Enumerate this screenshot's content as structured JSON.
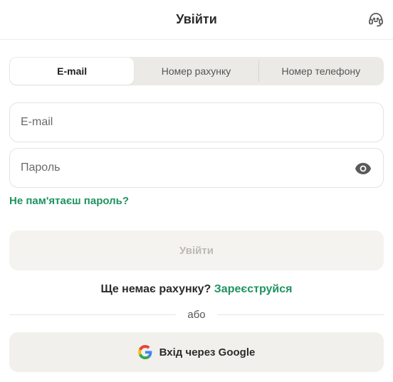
{
  "header": {
    "title": "Увійти",
    "support_icon": "headset-icon"
  },
  "tabs": [
    {
      "label": "E-mail",
      "active": true
    },
    {
      "label": "Номер рахунку",
      "active": false
    },
    {
      "label": "Номер телефону",
      "active": false
    }
  ],
  "form": {
    "email_placeholder": "E-mail",
    "email_value": "",
    "password_placeholder": "Пароль",
    "password_value": "",
    "password_toggle_icon": "eye-icon",
    "forgot_label": "Не пам'ятаєш пароль?",
    "submit_label": "Увійти"
  },
  "signup": {
    "prompt": "Ще немає рахунку?",
    "link_label": "Зареєструйся"
  },
  "divider": {
    "label": "або"
  },
  "google": {
    "label": "Вхід через Google",
    "icon": "google-logo-icon"
  },
  "colors": {
    "accent": "#1f9360",
    "tab_bg": "#ebeae6",
    "button_bg": "#f4f3ef"
  }
}
